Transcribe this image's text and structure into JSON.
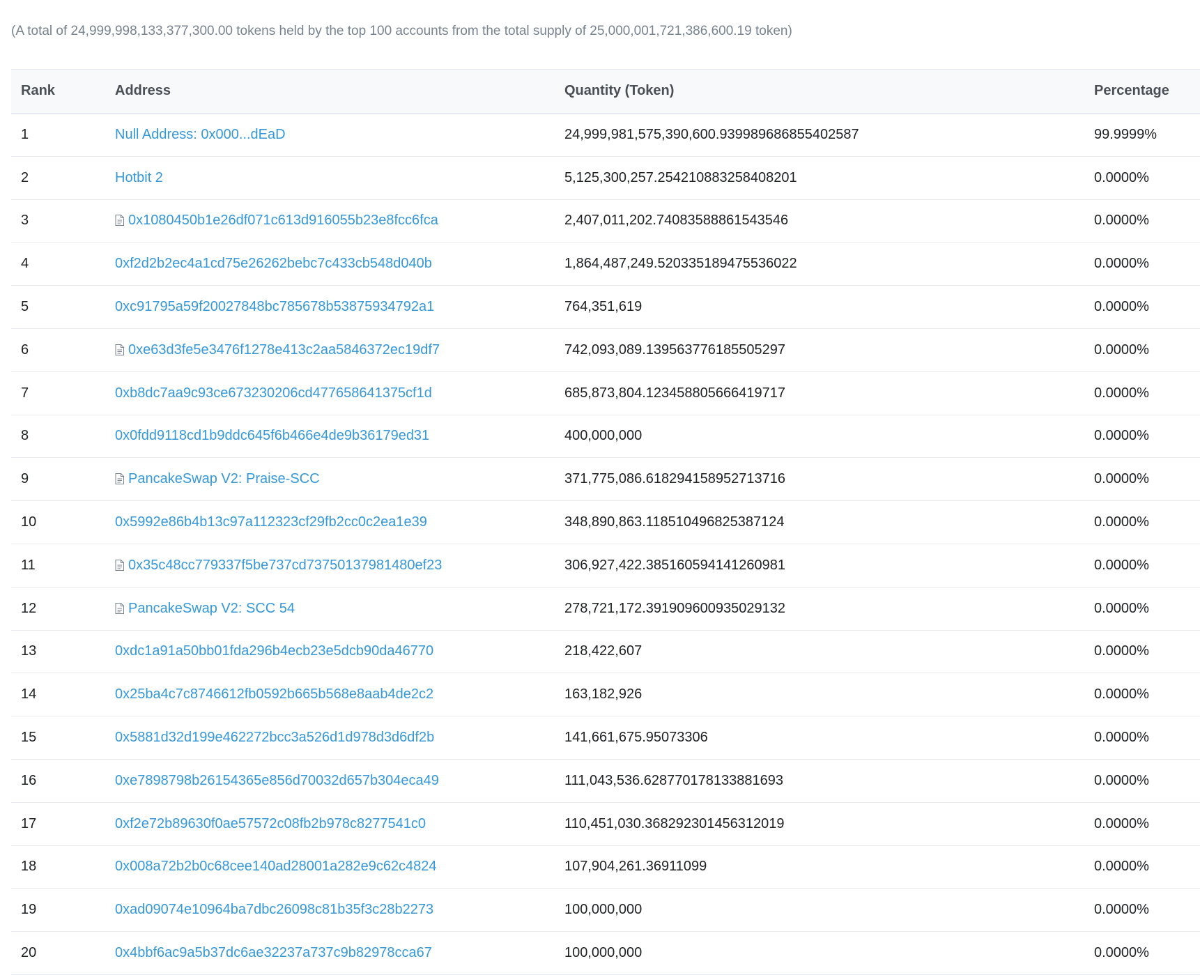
{
  "summary": "(A total of 24,999,998,133,377,300.00 tokens held by the top 100 accounts from the total supply of 25,000,001,721,386,600.19 token)",
  "colors": {
    "link": "#3498db",
    "muted": "#77838f",
    "header_bg": "#f8f9fa",
    "border": "#e7eaf3"
  },
  "table": {
    "headers": {
      "rank": "Rank",
      "address": "Address",
      "quantity": "Quantity (Token)",
      "percentage": "Percentage"
    },
    "rows": [
      {
        "rank": "1",
        "address": "Null Address: 0x000...dEaD",
        "contract": false,
        "quantity": "24,999,981,575,390,600.939989686855402587",
        "percentage": "99.9999%"
      },
      {
        "rank": "2",
        "address": "Hotbit 2",
        "contract": false,
        "quantity": "5,125,300,257.254210883258408201",
        "percentage": "0.0000%"
      },
      {
        "rank": "3",
        "address": "0x1080450b1e26df071c613d916055b23e8fcc6fca",
        "contract": true,
        "quantity": "2,407,011,202.74083588861543546",
        "percentage": "0.0000%"
      },
      {
        "rank": "4",
        "address": "0xf2d2b2ec4a1cd75e26262bebc7c433cb548d040b",
        "contract": false,
        "quantity": "1,864,487,249.520335189475536022",
        "percentage": "0.0000%"
      },
      {
        "rank": "5",
        "address": "0xc91795a59f20027848bc785678b53875934792a1",
        "contract": false,
        "quantity": "764,351,619",
        "percentage": "0.0000%"
      },
      {
        "rank": "6",
        "address": "0xe63d3fe5e3476f1278e413c2aa5846372ec19df7",
        "contract": true,
        "quantity": "742,093,089.139563776185505297",
        "percentage": "0.0000%"
      },
      {
        "rank": "7",
        "address": "0xb8dc7aa9c93ce673230206cd477658641375cf1d",
        "contract": false,
        "quantity": "685,873,804.123458805666419717",
        "percentage": "0.0000%"
      },
      {
        "rank": "8",
        "address": "0x0fdd9118cd1b9ddc645f6b466e4de9b36179ed31",
        "contract": false,
        "quantity": "400,000,000",
        "percentage": "0.0000%"
      },
      {
        "rank": "9",
        "address": "PancakeSwap V2: Praise-SCC",
        "contract": true,
        "quantity": "371,775,086.618294158952713716",
        "percentage": "0.0000%"
      },
      {
        "rank": "10",
        "address": "0x5992e86b4b13c97a112323cf29fb2cc0c2ea1e39",
        "contract": false,
        "quantity": "348,890,863.118510496825387124",
        "percentage": "0.0000%"
      },
      {
        "rank": "11",
        "address": "0x35c48cc779337f5be737cd73750137981480ef23",
        "contract": true,
        "quantity": "306,927,422.385160594141260981",
        "percentage": "0.0000%"
      },
      {
        "rank": "12",
        "address": "PancakeSwap V2: SCC 54",
        "contract": true,
        "quantity": "278,721,172.391909600935029132",
        "percentage": "0.0000%"
      },
      {
        "rank": "13",
        "address": "0xdc1a91a50bb01fda296b4ecb23e5dcb90da46770",
        "contract": false,
        "quantity": "218,422,607",
        "percentage": "0.0000%"
      },
      {
        "rank": "14",
        "address": "0x25ba4c7c8746612fb0592b665b568e8aab4de2c2",
        "contract": false,
        "quantity": "163,182,926",
        "percentage": "0.0000%"
      },
      {
        "rank": "15",
        "address": "0x5881d32d199e462272bcc3a526d1d978d3d6df2b",
        "contract": false,
        "quantity": "141,661,675.95073306",
        "percentage": "0.0000%"
      },
      {
        "rank": "16",
        "address": "0xe7898798b26154365e856d70032d657b304eca49",
        "contract": false,
        "quantity": "111,043,536.628770178133881693",
        "percentage": "0.0000%"
      },
      {
        "rank": "17",
        "address": "0xf2e72b89630f0ae57572c08fb2b978c8277541c0",
        "contract": false,
        "quantity": "110,451,030.368292301456312019",
        "percentage": "0.0000%"
      },
      {
        "rank": "18",
        "address": "0x008a72b2b0c68cee140ad28001a282e9c62c4824",
        "contract": false,
        "quantity": "107,904,261.36911099",
        "percentage": "0.0000%"
      },
      {
        "rank": "19",
        "address": "0xad09074e10964ba7dbc26098c81b35f3c28b2273",
        "contract": false,
        "quantity": "100,000,000",
        "percentage": "0.0000%"
      },
      {
        "rank": "20",
        "address": "0x4bbf6ac9a5b37dc6ae32237a737c9b82978cca67",
        "contract": false,
        "quantity": "100,000,000",
        "percentage": "0.0000%"
      }
    ]
  }
}
